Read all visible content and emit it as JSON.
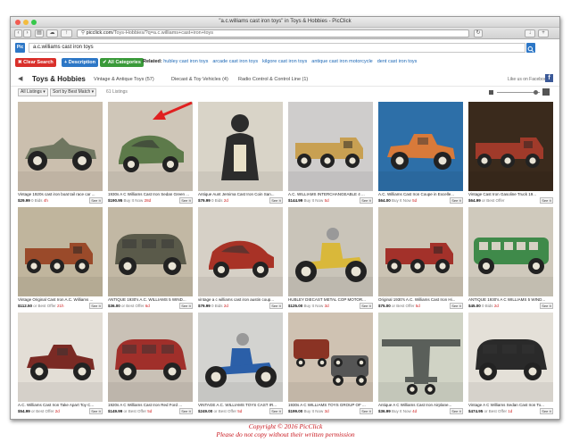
{
  "window": {
    "title": "\"a.c.williams cast iron toys\" in Toys & Hobbies - PicClick"
  },
  "browser": {
    "url_host": "picclick.com",
    "url_path": "/Toys-Hobbies/?q=a.c.williams+cast+iron+toys"
  },
  "site": {
    "logo": "Pic"
  },
  "search": {
    "query": "a.c.williams cast iron toys"
  },
  "filters": {
    "clear": "✖ Clear Search",
    "description": "+ Description",
    "all_categories": "✔ All Categories",
    "related_label": "Related:"
  },
  "related": [
    "hubley cast iron toys",
    "arcade cast iron toys",
    "kilgore cast iron toys",
    "antique cast iron motorcycle",
    "dent cast iron toys"
  ],
  "category": {
    "back": "◀",
    "current": "Toys & Hobbies",
    "subs": [
      "Vintage & Antique Toys (57)",
      "Diecast & Toy Vehicles (4)",
      "Radio Control & Control Line (1)"
    ],
    "like": "Like us on Facebook"
  },
  "sort": {
    "listings": "All Listings ▾",
    "best_match": "Sort by Best Match ▾",
    "count": "61 Listings"
  },
  "listings": [
    {
      "title": "Vintage 1920s cast iron boat tail race car ...",
      "price": "$29.99",
      "extra": "0 Bids",
      "bids": "4h",
      "bg": "#cbbfae",
      "scene": "race",
      "body": "#6f7660"
    },
    {
      "title": "1930s A C Williams Cast Iron Sedan Green ...",
      "price": "$190.95",
      "extra": "Buy It Now",
      "bids": "28d",
      "bg": "#cfc6b8",
      "scene": "car",
      "body": "#5d7a4a"
    },
    {
      "title": "Antique Aunt Jemima Cast Iron Coin San...",
      "price": "$79.99",
      "extra": "0 Bids",
      "bids": "2d",
      "bg": "#d9d4c8",
      "scene": "figure",
      "body": "#2c2c2c"
    },
    {
      "title": "A.C. WILLIAMS INTERCHANGEABLE 4 ...",
      "price": "$144.99",
      "extra": "Buy It Now",
      "bids": "5d",
      "bg": "#cfcdcc",
      "scene": "truck",
      "body": "#c8a052"
    },
    {
      "title": "A.C. Williams Cast Iron Coupe in Excelle...",
      "price": "$64.00",
      "extra": "Buy It Now",
      "bids": "5d",
      "bg": "#2d6fa8",
      "scene": "coupe",
      "body": "#d87a3a"
    },
    {
      "title": "Vintage Cast Iron Gasoline Truck 19...",
      "price": "$64.99",
      "extra": "or Best Offer",
      "bids": "",
      "bg": "#3a2a1c",
      "scene": "truck",
      "body": "#a03a2a"
    },
    {
      "title": "Vintage Original Cast Iron A.C. Williams ...",
      "price": "$112.50",
      "extra": "or Best Offer",
      "bids": "21h",
      "bg": "#c0b59d",
      "scene": "truck",
      "body": "#9a4a2a"
    },
    {
      "title": "ANTIQUE 1930's A.C. WILLIAMS 5 WIND...",
      "price": "$36.00",
      "extra": "or Best Offer",
      "bids": "6d",
      "bg": "#c2b8a4",
      "scene": "sedan",
      "body": "#5a5a4a"
    },
    {
      "title": "vintage a c williams cast iron austin coup...",
      "price": "$79.99",
      "extra": "0 Bids",
      "bids": "2d",
      "bg": "#d6d0c6",
      "scene": "car",
      "body": "#a83226"
    },
    {
      "title": "HUBLEY DIECAST METAL COP MOTOR...",
      "price": "$125.00",
      "extra": "Buy It Now",
      "bids": "3d",
      "bg": "#c9c4b9",
      "scene": "moto",
      "body": "#d9b83a"
    },
    {
      "title": "Original 1930's A.C. Williams Cast Iron Hi...",
      "price": "$75.00",
      "extra": "or Best Offer",
      "bids": "5d",
      "bg": "#cbc3b3",
      "scene": "truck",
      "body": "#a3312a"
    },
    {
      "title": "ANTIQUE 1930's A C WILLIAMS 5 WIND...",
      "price": "$45.00",
      "extra": "0 Bids",
      "bids": "2d",
      "bg": "#cfc9bc",
      "scene": "bus",
      "body": "#3f8a4a"
    },
    {
      "title": "A.C. Williams Cast Iron Take Apart Toy C...",
      "price": "$54.99",
      "extra": "or Best Offer",
      "bids": "2d",
      "bg": "#e3ded6",
      "scene": "coupe",
      "body": "#7a2a24"
    },
    {
      "title": "1920s A C Williams Cast Iron Red Ford ...",
      "price": "$149.99",
      "extra": "or Best Offer",
      "bids": "5d",
      "bg": "#c9c1b6",
      "scene": "sedan",
      "body": "#a02f2a"
    },
    {
      "title": "VINTAGE A.C. WILLIAMS TOYS CAST IR...",
      "price": "$249.00",
      "extra": "or Best Offer",
      "bids": "5d",
      "bg": "#d3d3d0",
      "scene": "moto",
      "body": "#2b5fa8"
    },
    {
      "title": "1930s A C WILLIAMS TOYS GROUP OF ...",
      "price": "$199.00",
      "extra": "Buy It Now",
      "bids": "3d",
      "bg": "#cfc2b2",
      "scene": "group",
      "body": "#8a3324"
    },
    {
      "title": "Antique A C Williams Cast Iron Airplane...",
      "price": "$36.99",
      "extra": "Buy It Now",
      "bids": "4d",
      "bg": "#d0d3c5",
      "scene": "plane",
      "body": "#5a5f5a"
    },
    {
      "title": "Vintage A C Williams Sedan Cast Iron To...",
      "price": "$474.95",
      "extra": "or Best Offer",
      "bids": "1d",
      "bg": "#e4e0d8",
      "scene": "sedan",
      "body": "#2a2a2a"
    }
  ],
  "see_it": "See It",
  "annotation": {
    "color": "#e02020"
  },
  "copyright": {
    "line1": "Copyright © 2016       PicClick",
    "line2": "Please do not copy without their written permission"
  }
}
